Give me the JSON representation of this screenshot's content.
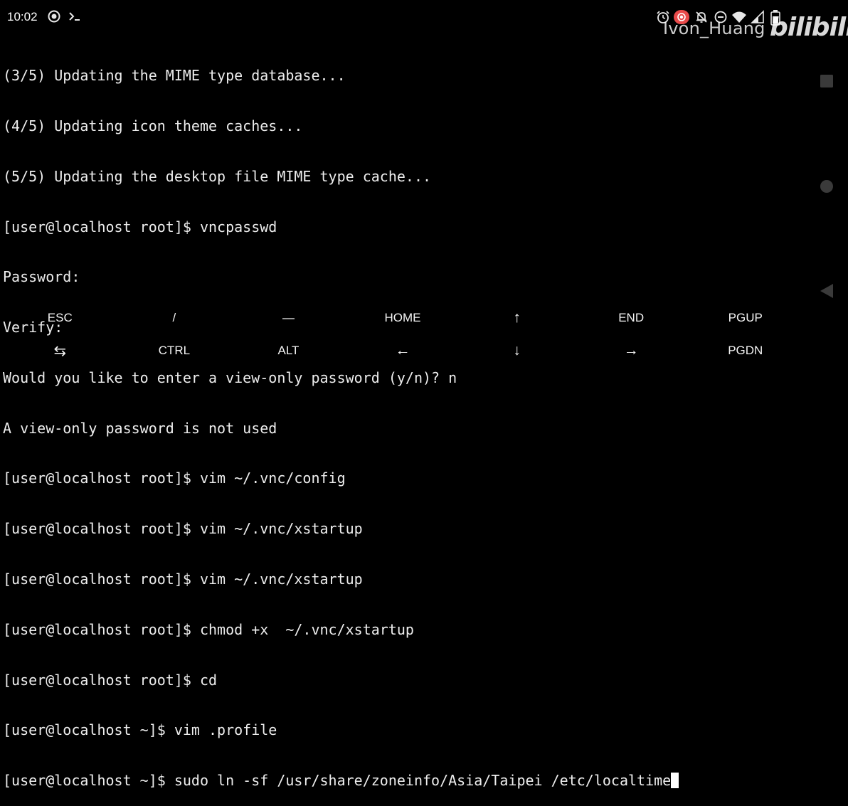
{
  "status_bar": {
    "time": "10:02",
    "left_icons": [
      "screen-record-icon",
      "terminal-prompt-icon"
    ],
    "right_icons": [
      "alarm-icon",
      "record-indicator-icon",
      "notifications-muted-icon",
      "do-not-disturb-icon",
      "wifi-icon",
      "signal-icon",
      "battery-icon"
    ]
  },
  "watermark": {
    "user": "Ivon_Huang",
    "logo": "bilibili"
  },
  "terminal": {
    "lines": [
      "(3/5) Updating the MIME type database...",
      "(4/5) Updating icon theme caches...",
      "(5/5) Updating the desktop file MIME type cache...",
      "[user@localhost root]$ vncpasswd",
      "Password:",
      "Verify:",
      "Would you like to enter a view-only password (y/n)? n",
      "A view-only password is not used",
      "[user@localhost root]$ vim ~/.vnc/config",
      "[user@localhost root]$ vim ~/.vnc/xstartup",
      "[user@localhost root]$ vim ~/.vnc/xstartup",
      "[user@localhost root]$ chmod +x  ~/.vnc/xstartup",
      "[user@localhost root]$ cd",
      "[user@localhost ~]$ vim .profile",
      "[user@localhost ~]$ sudo ln -sf /usr/share/zoneinfo/Asia/Taipei /etc/localtime"
    ]
  },
  "extra_keys": {
    "row1": [
      "ESC",
      "/",
      "—",
      "HOME",
      "↑",
      "END",
      "PGUP"
    ],
    "row2": [
      "⇆",
      "CTRL",
      "ALT",
      "←",
      "↓",
      "→",
      "PGDN"
    ]
  },
  "nav_bar": {
    "buttons": [
      "recents-square-icon",
      "home-circle-icon",
      "back-triangle-icon"
    ]
  },
  "colors": {
    "background": "#000000",
    "text": "#ededed"
  }
}
